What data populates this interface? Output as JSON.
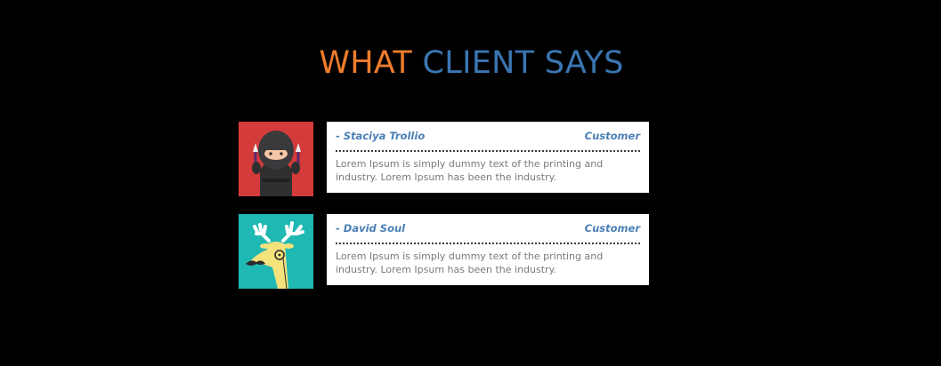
{
  "heading": {
    "word1": "WHAT",
    "word2": "CLIENT SAYS"
  },
  "colors": {
    "accent_orange": "#ef7d2c",
    "accent_blue": "#3b76b2",
    "background": "#000000",
    "card": "#ffffff"
  },
  "testimonials": [
    {
      "name": "- Staciya Trollio",
      "role": "Customer",
      "text": "Lorem Ipsum is simply dummy text of the printing and industry. Lorem Ipsum has been the industry.",
      "avatar_icon": "ninja-avatar-icon",
      "avatar_bg": "#d43b3b"
    },
    {
      "name": "- David Soul",
      "role": "Customer",
      "text": "Lorem Ipsum is simply dummy text of the printing and industry. Lorem Ipsum has been the industry.",
      "avatar_icon": "deer-avatar-icon",
      "avatar_bg": "#1fb8b3"
    }
  ]
}
